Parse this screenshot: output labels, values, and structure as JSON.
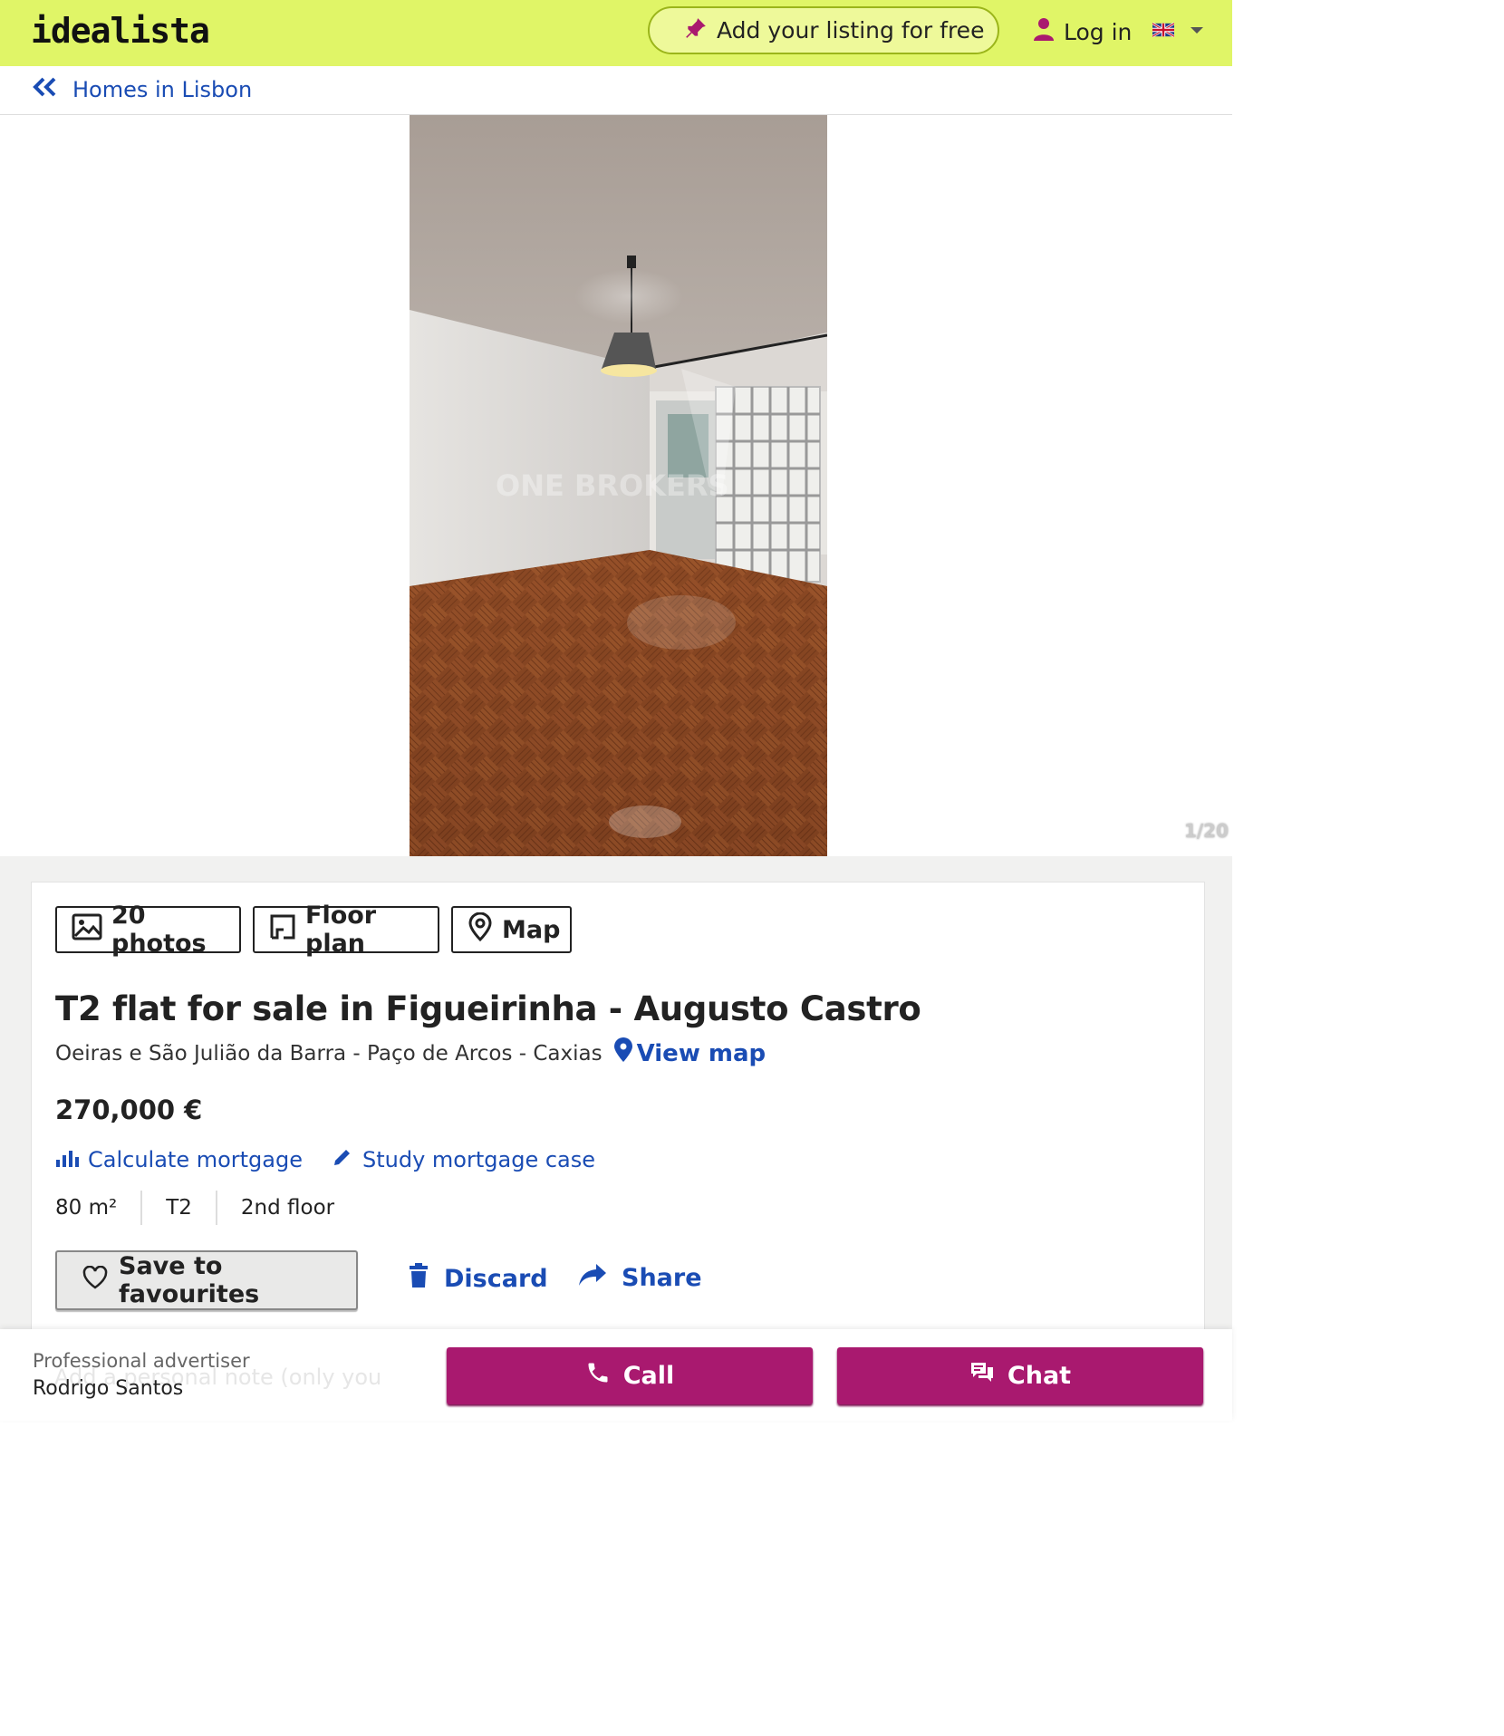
{
  "header": {
    "logo": "idealista",
    "add_listing": "Add your listing for free",
    "login": "Log in",
    "language_icon": "uk-flag-icon"
  },
  "breadcrumb": {
    "label": "Homes in Lisbon"
  },
  "gallery": {
    "counter": "1/20",
    "watermark": "ONE BROKERS"
  },
  "media_buttons": {
    "photos": "20 photos",
    "floor_plan": "Floor plan",
    "map": "Map"
  },
  "listing": {
    "title": "T2 flat for sale in Figueirinha - Augusto Castro",
    "location": "Oeiras e São Julião da Barra - Paço de Arcos - Caxias",
    "view_map": "View map",
    "price": "270,000 €",
    "calc_mortgage": "Calculate mortgage",
    "study_mortgage": "Study mortgage case",
    "features": [
      "80 m²",
      "T2",
      "2nd floor"
    ]
  },
  "actions": {
    "save": "Save to favourites",
    "discard": "Discard",
    "share": "Share"
  },
  "bottom_bar": {
    "note_placeholder": "Add a personal note (only you",
    "advertiser_label": "Professional advertiser",
    "advertiser_name": "Rodrigo Santos",
    "call": "Call",
    "chat": "Chat"
  },
  "colors": {
    "brand_yellow": "#e0f567",
    "accent_magenta": "#a9196f",
    "link_blue": "#1a4cb4"
  }
}
